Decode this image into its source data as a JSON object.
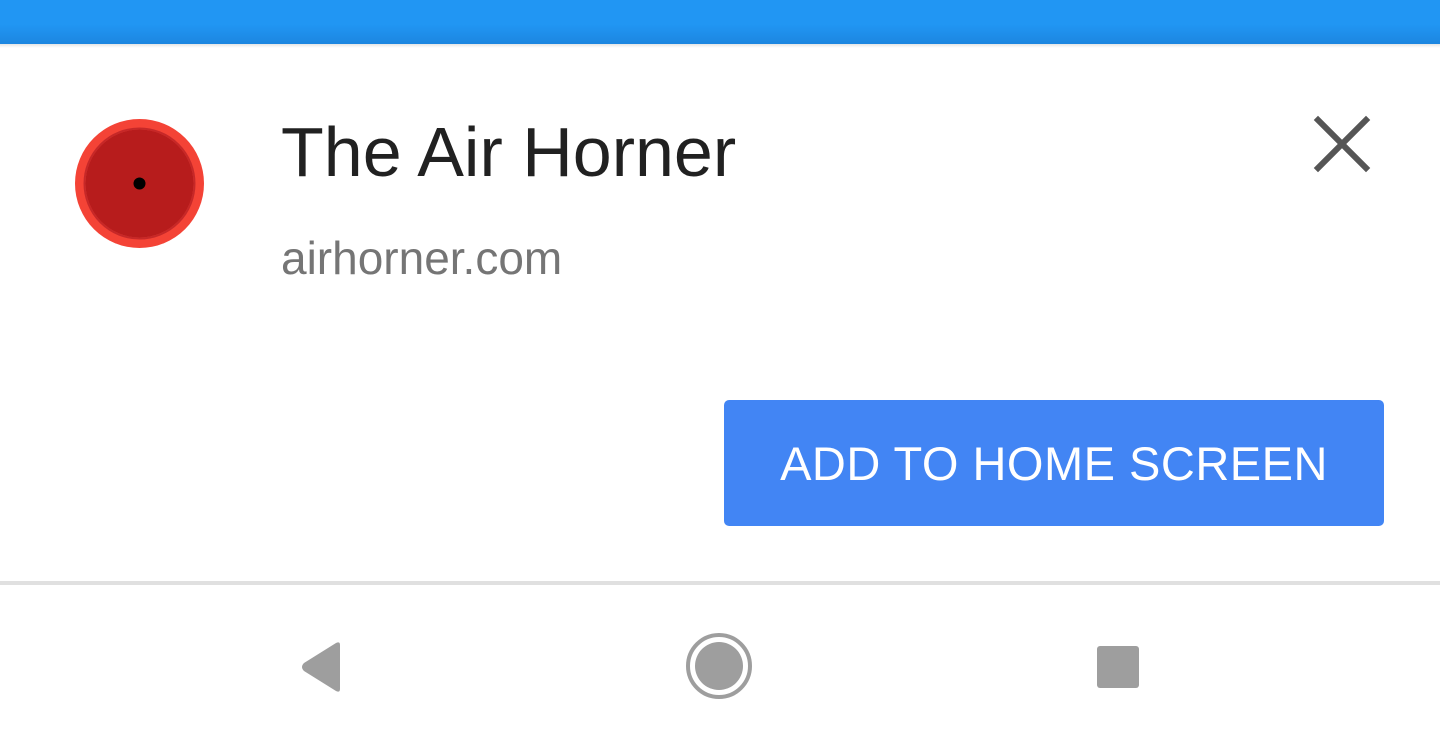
{
  "app": {
    "title": "The Air Horner",
    "url": "airhorner.com",
    "icon": "airhorner-app-icon"
  },
  "actions": {
    "add_label": "ADD TO HOME SCREEN",
    "close_icon": "close-icon"
  },
  "nav": {
    "back_icon": "back-triangle-icon",
    "home_icon": "home-circle-icon",
    "recents_icon": "recents-square-icon"
  },
  "colors": {
    "status_bar": "#2196f3",
    "button": "#4285f4",
    "title_text": "#212121",
    "url_text": "#757575",
    "icon_outer": "#f44336",
    "icon_inner": "#b71c1c",
    "nav_icons": "#9e9e9e"
  }
}
